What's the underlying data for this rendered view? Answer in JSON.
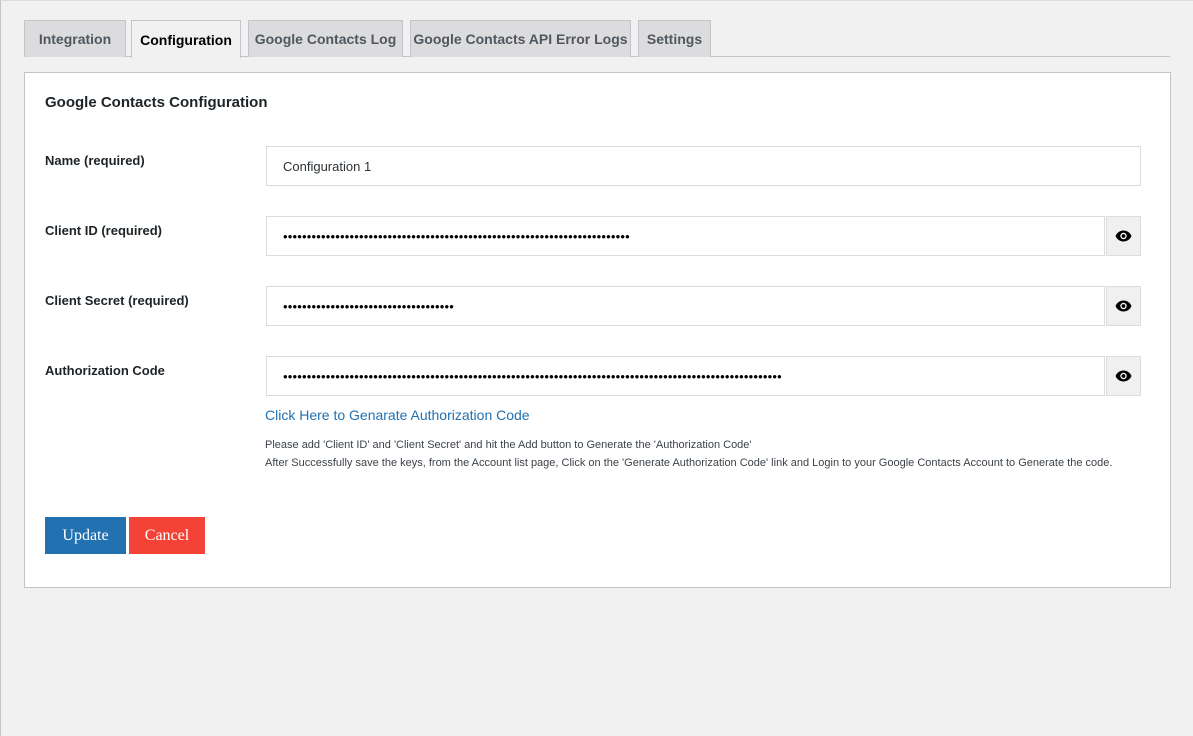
{
  "tabs": [
    {
      "label": "Integration",
      "active": false
    },
    {
      "label": "Configuration",
      "active": true
    },
    {
      "label": "Google Contacts Log",
      "active": false
    },
    {
      "label": "Google Contacts API Error Logs",
      "active": false
    },
    {
      "label": "Settings",
      "active": false
    }
  ],
  "panel": {
    "title": "Google Contacts Configuration"
  },
  "form": {
    "name": {
      "label": "Name (required)",
      "value": "Configuration 1"
    },
    "client_id": {
      "label": "Client ID (required)",
      "value": "•••••••••••••••••••••••••••••••••••••••••••••••••••••••••••••••••••••••••"
    },
    "client_secret": {
      "label": "Client Secret (required)",
      "value": "••••••••••••••••••••••••••••••••••••"
    },
    "auth_code": {
      "label": "Authorization Code",
      "value": "•••••••••••••••••••••••••••••••••••••••••••••••••••••••••••••••••••••••••••••••••••••••••••••••••••••••••"
    }
  },
  "auth_link": "Click Here to Genarate Authorization Code",
  "help": {
    "line1": "Please add 'Client ID' and 'Client Secret' and hit the Add button to Generate the 'Authorization Code'",
    "line2": "After Successfully save the keys, from the Account list page, Click on the 'Generate Authorization Code' link and Login to your Google Contacts Account to Generate the code."
  },
  "buttons": {
    "update": "Update",
    "cancel": "Cancel"
  },
  "icons": {
    "reveal": "eye-icon"
  },
  "colors": {
    "primary": "#2271b1",
    "danger": "#f44336"
  }
}
